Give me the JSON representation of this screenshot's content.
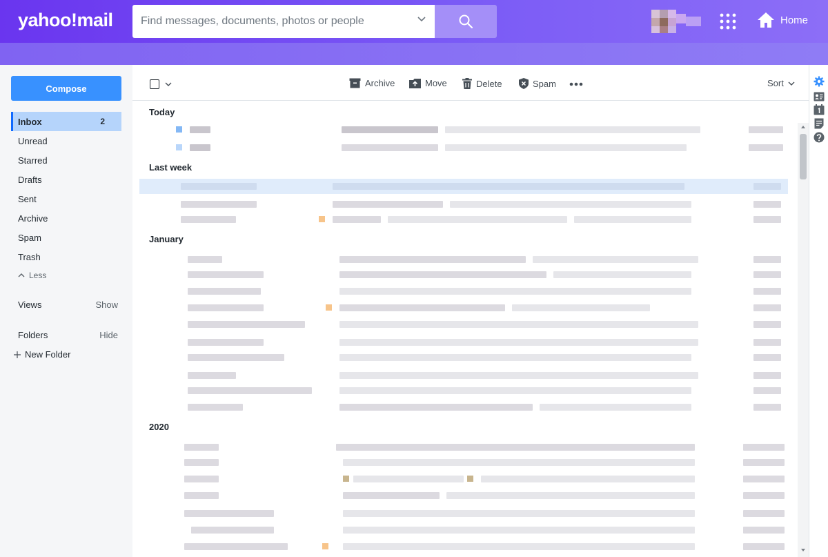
{
  "header": {
    "logo": "yahoo!mail",
    "search_placeholder": "Find messages, documents, photos or people",
    "home_label": "Home"
  },
  "sidebar": {
    "compose_label": "Compose",
    "items": [
      {
        "label": "Inbox",
        "count": "2",
        "active": true
      },
      {
        "label": "Unread"
      },
      {
        "label": "Starred"
      },
      {
        "label": "Drafts"
      },
      {
        "label": "Sent"
      },
      {
        "label": "Archive"
      },
      {
        "label": "Spam"
      },
      {
        "label": "Trash"
      }
    ],
    "less_label": "Less",
    "views_label": "Views",
    "views_action": "Show",
    "folders_label": "Folders",
    "folders_action": "Hide",
    "new_folder_label": "New Folder"
  },
  "toolbar": {
    "archive_label": "Archive",
    "move_label": "Move",
    "delete_label": "Delete",
    "spam_label": "Spam",
    "sort_label": "Sort"
  },
  "groups": {
    "today": "Today",
    "last_week": "Last week",
    "january": "January",
    "y2020": "2020"
  },
  "colors": {
    "header_gradient_start": "#6a35ef",
    "header_gradient_end": "#8c6ef7",
    "compose": "#3891ff",
    "inbox_active": "#b5d4fb",
    "unread_marker": "#84b8f5",
    "flag_marker": "#f7c48a"
  }
}
